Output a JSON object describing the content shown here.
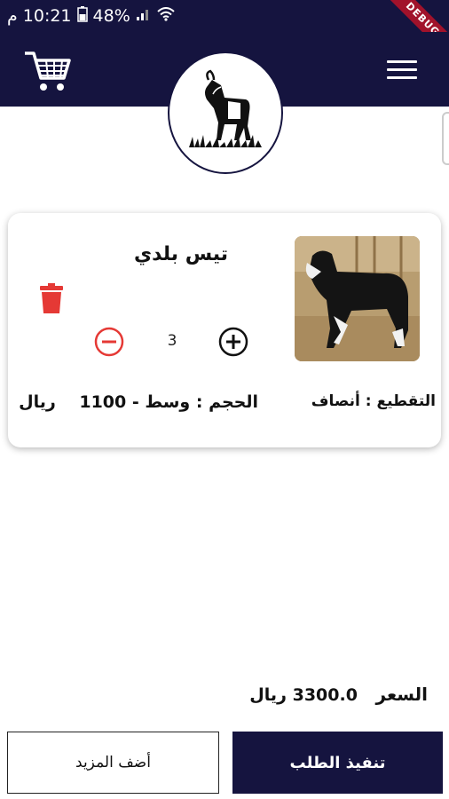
{
  "status_bar": {
    "time": "10:21",
    "am_pm": "م",
    "battery": "48%"
  },
  "debug_ribbon": "DEBUG",
  "app_bar": {
    "cart_icon": "cart-icon",
    "menu_icon": "hamburger-menu-icon",
    "logo_icon": "goat-logo-icon"
  },
  "cart_item": {
    "name": "تيس بلدي",
    "quantity": "3",
    "size_label": "الحجم",
    "size_value": "وسط",
    "price": "1100",
    "currency": "ريال",
    "cut_label": "التقطيع",
    "cut_value": "أنصاف",
    "image_icon": "goat-photo"
  },
  "total": {
    "label": "السعر",
    "amount": "3300.0",
    "currency": "ريال"
  },
  "buttons": {
    "checkout": "تنفيذ الطلب",
    "add_more": "أضف المزيد"
  },
  "colors": {
    "primary": "#15143f",
    "delete": "#e53935",
    "minus": "#e53935",
    "plus": "#111111"
  }
}
